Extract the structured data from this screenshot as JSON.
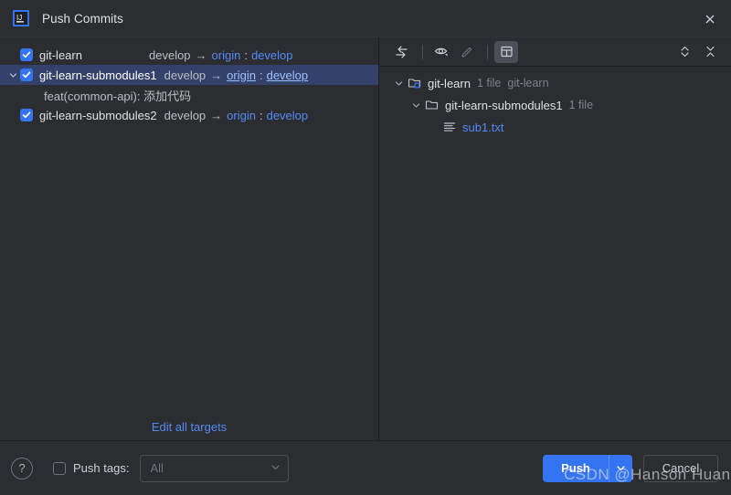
{
  "window": {
    "title": "Push Commits",
    "logo_icon": "intellij-idea-icon",
    "close_icon": "close-icon"
  },
  "left_panel": {
    "rows": [
      {
        "checked": true,
        "selected": false,
        "expandable": false,
        "twisty_icon": "",
        "repo": "git-learn",
        "local_branch": "develop",
        "arrow": "→",
        "remote": "origin",
        "colon": ":",
        "remote_branch": "develop"
      },
      {
        "checked": true,
        "selected": true,
        "expandable": true,
        "twisty_icon": "chevron-down-icon",
        "repo": "git-learn-submodules1",
        "local_branch": "develop",
        "arrow": "→",
        "remote": "origin",
        "colon": ":",
        "remote_branch": "develop"
      },
      {
        "checked": true,
        "selected": false,
        "expandable": false,
        "twisty_icon": "",
        "repo": "git-learn-submodules2",
        "local_branch": "develop",
        "arrow": "→",
        "remote": "origin",
        "colon": ":",
        "remote_branch": "develop"
      }
    ],
    "commit_message": "feat(common-api): 添加代码",
    "edit_all_targets": "Edit all targets"
  },
  "right_panel": {
    "toolbar": {
      "expand_to_changes": "expand-to-changes-icon",
      "preview": "eye-preview-icon",
      "edit_source": "pencil-edit-icon",
      "group_by": "group-by-panel-icon",
      "expand_all": "expand-all-icon",
      "collapse_all": "collapse-all-icon"
    },
    "tree": [
      {
        "level": 0,
        "twisty_icon": "chevron-down-icon",
        "icon": "module-folder-icon",
        "label": "git-learn",
        "count": "1 file",
        "extra": "git-learn",
        "is_file": false
      },
      {
        "level": 1,
        "twisty_icon": "chevron-down-icon",
        "icon": "folder-icon",
        "label": "git-learn-submodules1",
        "count": "1 file",
        "extra": "",
        "is_file": false
      },
      {
        "level": 2,
        "twisty_icon": "",
        "icon": "text-file-icon",
        "label": "sub1.txt",
        "count": "",
        "extra": "",
        "is_file": true
      }
    ]
  },
  "bottom_bar": {
    "help_label": "?",
    "push_tags_checked": false,
    "push_tags_label": "Push tags:",
    "push_tags_value": "All",
    "push_button": "Push",
    "push_dropdown_icon": "chevron-down-icon",
    "cancel_button": "Cancel"
  },
  "watermark": "CSDN @Hanson Huang",
  "colors": {
    "accent": "#3574F0",
    "selection": "#34426B",
    "link": "#548AF7",
    "panel_bg": "#2B2D30",
    "text": "#DFE1E5",
    "muted": "#7F8289"
  }
}
